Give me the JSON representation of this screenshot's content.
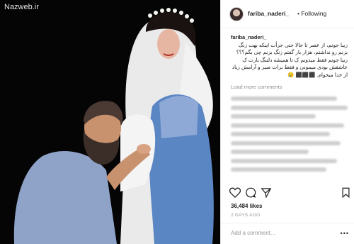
{
  "watermark": "Nazweb.ir",
  "post": {
    "username": "fariba_naderi_",
    "follow_label": "Following",
    "follow_separator": "•",
    "caption_user": "fariba_naderi_",
    "caption_text": "زیبا جونم، از عصر تا حالا حتی جرأت اینکه بهت زنگ بزنم رو نداشتم، هزار بار گفتم زنگ بزنم چی بگم؟؟؟ زیبا جونم فقط میدونم ک تا همیشه دلتنگ یارت ک عاشقش بودی میمونی و فقط برات صبر و آرامش زیاد از خدا میخوام. ⬛⬛⬛ 😢",
    "load_more": "Load more comments",
    "likes": "36,484 likes",
    "date": "2 DAYS AGO",
    "add_comment_placeholder": "Add a comment...",
    "more_label": "•••"
  },
  "icons": {
    "like": "heart-icon",
    "comment": "comment-icon",
    "share": "share-icon",
    "save": "bookmark-icon"
  },
  "colors": {
    "text": "#262626",
    "muted": "#8e8e8e",
    "photo_bg": "#050505",
    "dress": "#5b86c4"
  }
}
